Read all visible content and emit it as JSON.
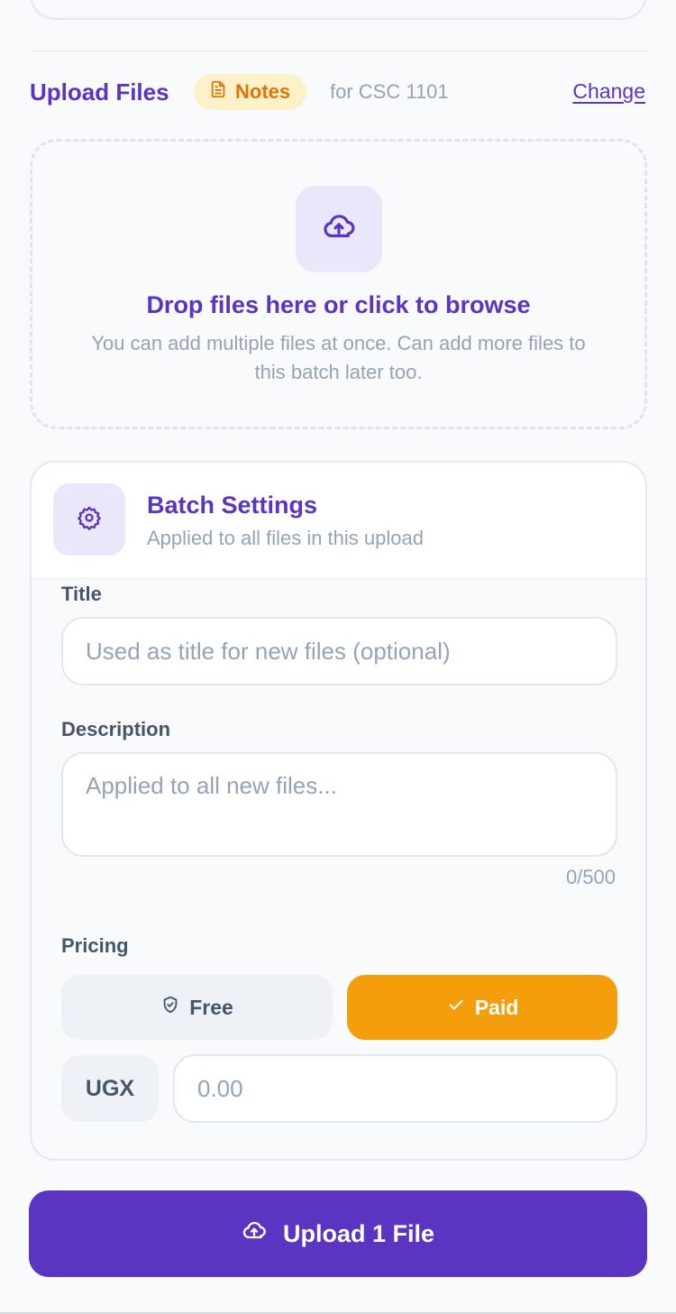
{
  "header": {
    "title": "Upload Files",
    "badge": "Notes",
    "badge_icon": "document-icon",
    "for_text": "for CSC 1101",
    "change_link": "Change"
  },
  "dropzone": {
    "icon": "cloud-upload-icon",
    "title": "Drop files here or click to browse",
    "subtitle": "You can add multiple files at once. Can add more files to this batch later too."
  },
  "batch_settings": {
    "icon": "gear-icon",
    "title": "Batch Settings",
    "subtitle": "Applied to all files in this upload",
    "title_label": "Title",
    "title_placeholder": "Used as title for new files (optional)",
    "description_label": "Description",
    "description_placeholder": "Applied to all new files...",
    "description_counter": "0/500",
    "pricing_label": "Pricing",
    "pricing_options": [
      {
        "label": "Free",
        "icon": "shield-check-icon",
        "selected": false
      },
      {
        "label": "Paid",
        "icon": "check-icon",
        "selected": true
      }
    ],
    "currency": "UGX",
    "amount_placeholder": "0.00"
  },
  "upload_button": {
    "label": "Upload 1 File",
    "icon": "cloud-upload-icon"
  },
  "colors": {
    "brand_purple": "#5b34c2",
    "accent_amber": "#f59e0b",
    "badge_bg": "#fdf1c9"
  }
}
